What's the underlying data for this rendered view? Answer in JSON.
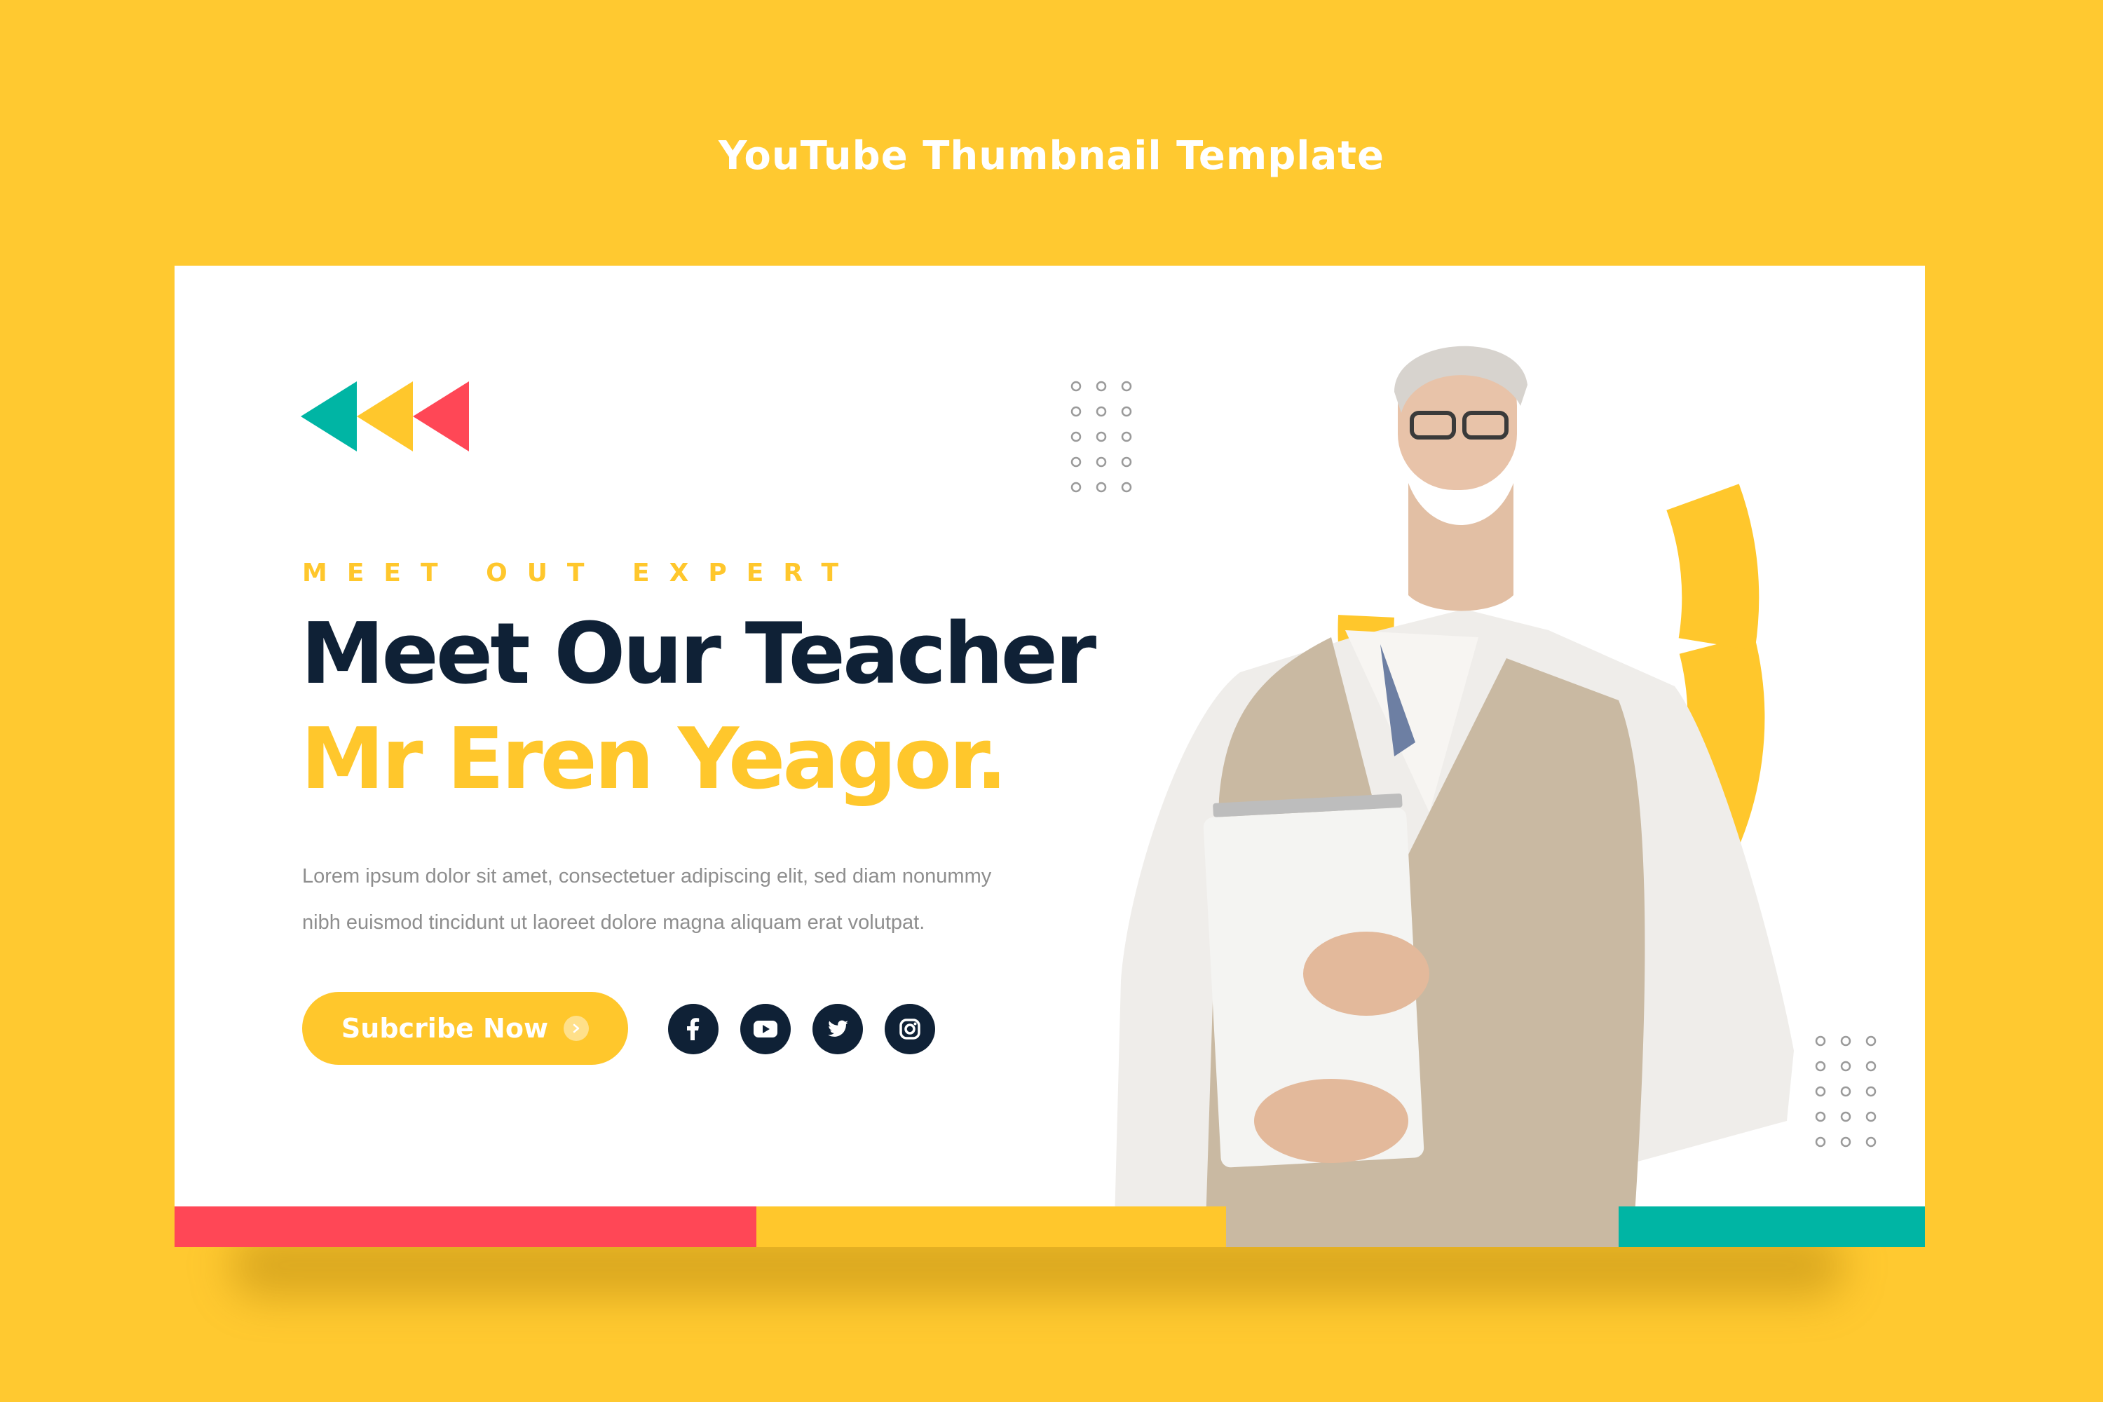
{
  "page": {
    "title": "YouTube Thumbnail Template"
  },
  "thumbnail": {
    "eyebrow": "MEET OUT EXPERT",
    "heading_line1": "Meet Our Teacher",
    "heading_line2": "Mr Eren Yeagor.",
    "description_line1": "Lorem ipsum dolor sit amet, consectetuer adipiscing elit, sed diam nonummy",
    "description_line2": "nibh euismod tincidunt ut laoreet dolore magna aliquam erat volutpat.",
    "subscribe_label": "Subcribe Now",
    "socials": [
      "facebook-icon",
      "youtube-icon",
      "twitter-icon",
      "instagram-icon"
    ]
  },
  "colors": {
    "background": "#FFC930",
    "accent_yellow": "#FFC72C",
    "navy": "#0F2136",
    "red": "#FF4756",
    "teal": "#00B5A4",
    "body_text": "#8E8E8E"
  }
}
